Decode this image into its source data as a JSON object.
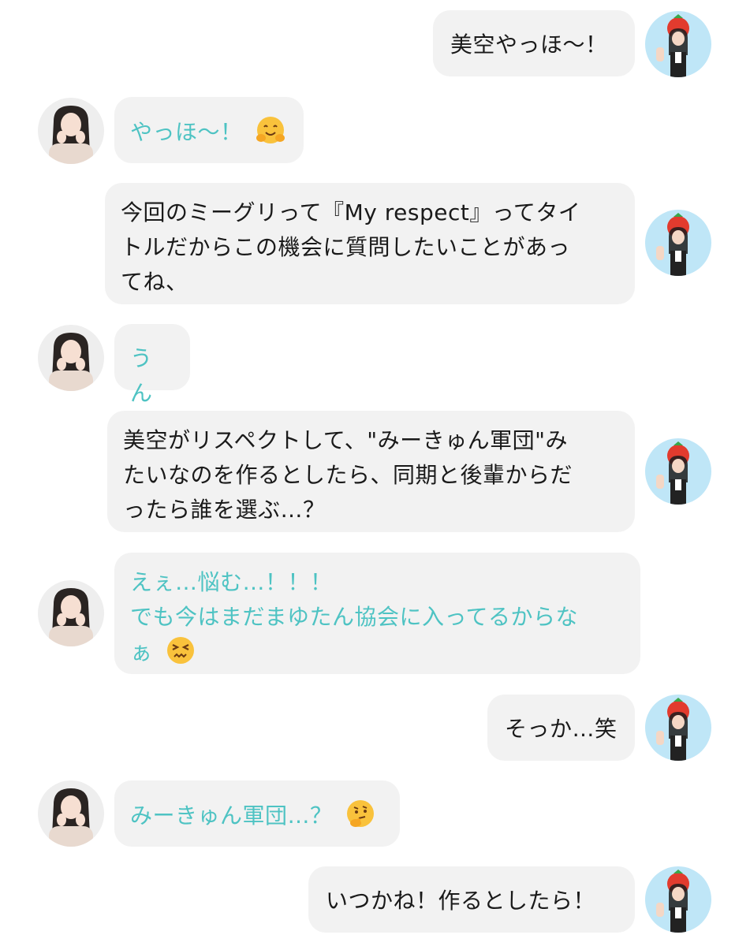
{
  "messages": [
    {
      "side": "user",
      "text": "美空やっほ〜！"
    },
    {
      "side": "idol",
      "text": "やっほ〜！",
      "emoji": "hugging-face-emoji"
    },
    {
      "side": "user",
      "text_lines": [
        "今回のミーグリって『My respect』ってタイ",
        "トルだからこの機会に質問したいことがあっ",
        "てね、"
      ]
    },
    {
      "side": "idol",
      "text": "うん"
    },
    {
      "side": "user",
      "text_lines": [
        "美空がリスペクトして、\"みーきゅん軍団\"み",
        "たいなのを作るとしたら、同期と後輩からだ",
        "ったら誰を選ぶ…？"
      ]
    },
    {
      "side": "idol",
      "text_lines": [
        "えぇ…悩む…！！！",
        "でも今はまだまゆたん協会に入ってるからな",
        "ぁ"
      ],
      "emoji": "confounded-face-emoji"
    },
    {
      "side": "user",
      "text": "そっか…笑"
    },
    {
      "side": "idol",
      "text": "みーきゅん軍団…？",
      "emoji": "thinking-face-emoji"
    },
    {
      "side": "user",
      "text": "いつかね！作るとしたら！"
    }
  ],
  "colors": {
    "bubble_bg": "#f2f2f2",
    "idol_text": "#4ec3c3",
    "user_text": "#1a1a1a"
  }
}
